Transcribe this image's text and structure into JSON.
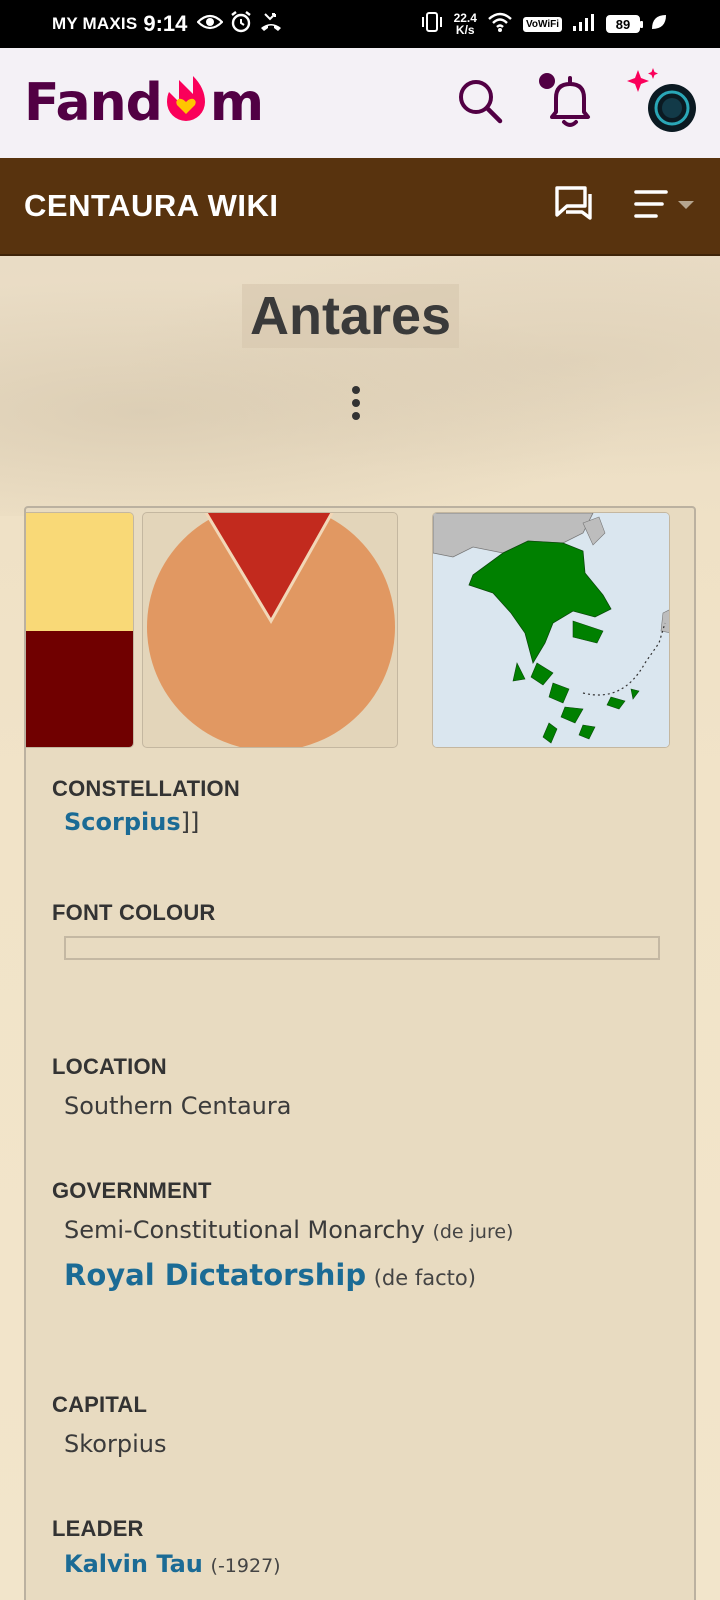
{
  "status_bar": {
    "carrier": "MY MAXIS",
    "time": "9:14",
    "net_speed_value": "22.4",
    "net_speed_unit": "K/s",
    "vowifi": "VoWiFi",
    "battery": "89"
  },
  "fandom": {
    "logo_left": "Fand",
    "logo_right": "m"
  },
  "wiki": {
    "name": "CENTAURA WIKI"
  },
  "page": {
    "title": "Antares"
  },
  "infobox": {
    "gallery": [
      "flag",
      "emblem",
      "map"
    ],
    "colors": {
      "flag_top": "#f9d977",
      "flag_bottom": "#700000",
      "emblem_field": "#e19862",
      "emblem_wedge": "#c22a1e",
      "map_land": "#008000",
      "map_sea": "#dae6ef"
    },
    "constellation": {
      "label": "CONSTELLATION",
      "link": "Scorpius",
      "trail": "]]"
    },
    "font_colour": {
      "label": "FONT COLOUR"
    },
    "location": {
      "label": "LOCATION",
      "value": "Southern Centaura"
    },
    "government": {
      "label": "GOVERNMENT",
      "value1": "Semi-Constitutional Monarchy",
      "note1": "(de jure)",
      "link2": "Royal Dictatorship",
      "note2": "(de facto)"
    },
    "capital": {
      "label": "CAPITAL",
      "value": "Skorpius"
    },
    "leader": {
      "label": "LEADER",
      "link": "Kalvin Tau",
      "note": "(-1927)"
    }
  }
}
